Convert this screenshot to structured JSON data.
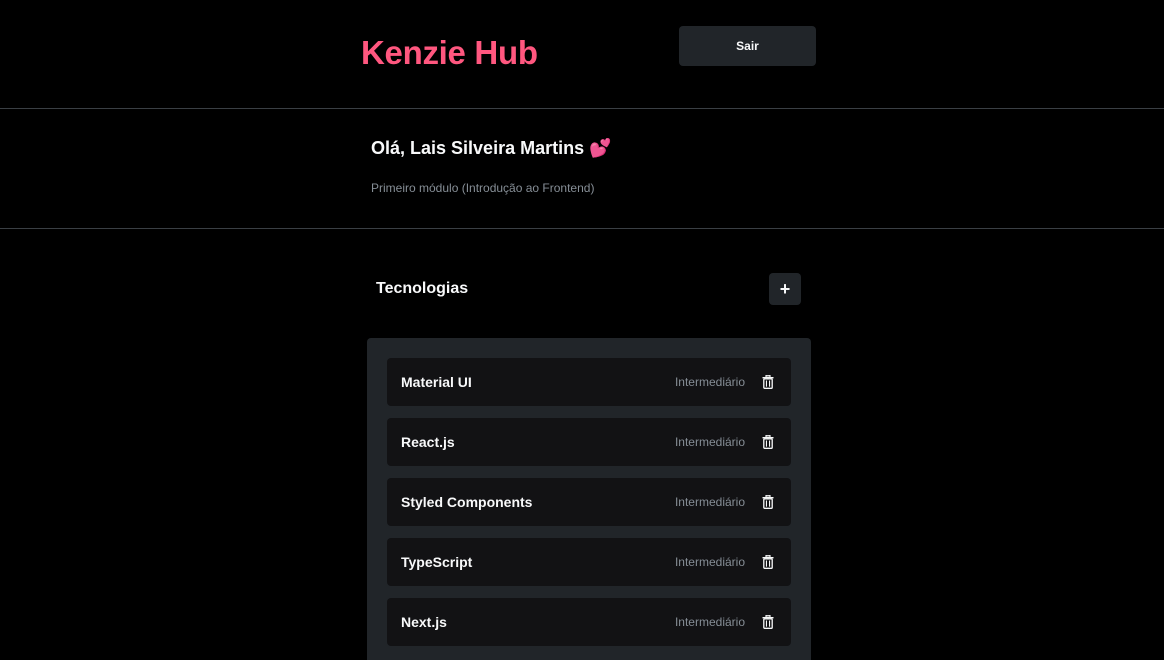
{
  "header": {
    "logo": "Kenzie Hub",
    "logout_label": "Sair"
  },
  "profile": {
    "greeting": "Olá, Lais Silveira Martins 💕",
    "module": "Primeiro módulo (Introdução ao Frontend)"
  },
  "technologies": {
    "title": "Tecnologias",
    "add_label": "+",
    "items": [
      {
        "name": "Material UI",
        "status": "Intermediário",
        "icon": "trash-icon"
      },
      {
        "name": "React.js",
        "status": "Intermediário",
        "icon": "trash-icon"
      },
      {
        "name": "Styled Components",
        "status": "Intermediário",
        "icon": "trash-icon"
      },
      {
        "name": "TypeScript",
        "status": "Intermediário",
        "icon": "trash-icon"
      },
      {
        "name": "Next.js",
        "status": "Intermediário",
        "icon": "trash-icon"
      }
    ]
  },
  "colors": {
    "brand": "#FF577F",
    "background": "#000000",
    "surface": "#212529",
    "card": "#121214",
    "text": "#F8F9FA",
    "muted": "#868E96"
  }
}
